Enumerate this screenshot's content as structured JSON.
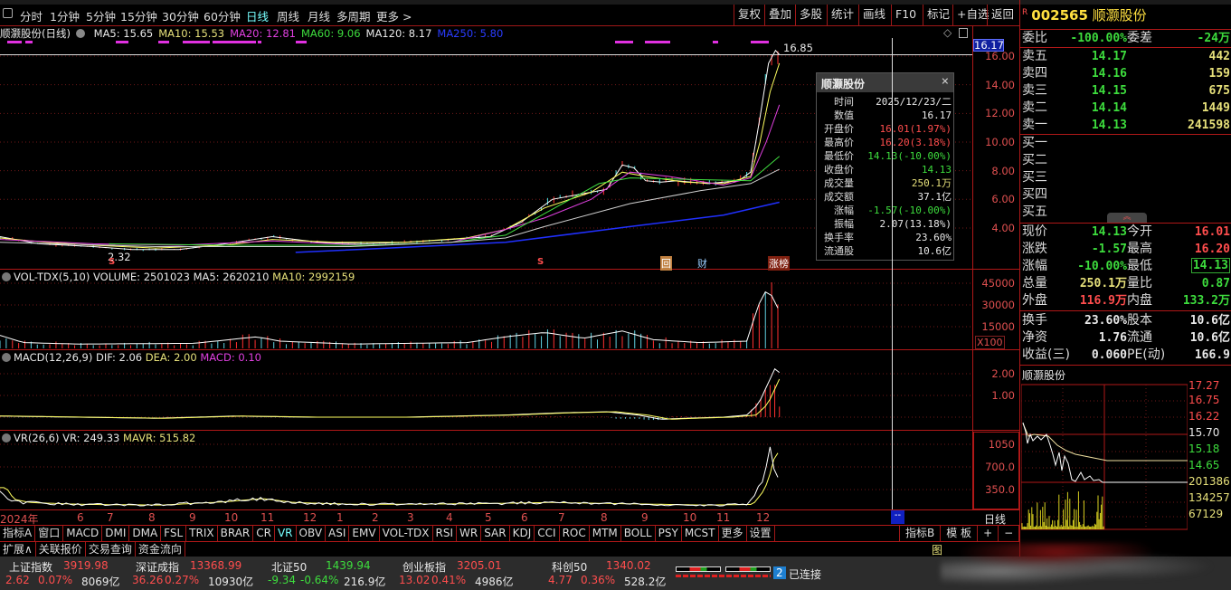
{
  "toolbar": {
    "periods": [
      "分时",
      "1分钟",
      "5分钟",
      "15分钟",
      "30分钟",
      "60分钟",
      "日线",
      "周线",
      "月线",
      "多周期",
      "更多 >"
    ],
    "active_period": "日线",
    "buttons": [
      "复权",
      "叠加",
      "多股",
      "统计",
      "画线",
      "F10",
      "标记",
      "+自选",
      "返回"
    ]
  },
  "info": {
    "title": "顺灏股份(日线)",
    "ma5": "MA5: 15.65",
    "ma10": "MA10: 15.53",
    "ma20": "MA20: 12.81",
    "ma60": "MA60: 9.06",
    "ma120": "MA120: 8.17",
    "ma250": "MA250: 5.80"
  },
  "price_axis": {
    "labels": [
      "16.00",
      "14.00",
      "12.00",
      "10.00",
      "8.00",
      "6.00",
      "4.00"
    ],
    "current": "16.17",
    "high_mark": "16.85",
    "low_mark": "2.32"
  },
  "markers": {
    "s1": "S",
    "s2": "S",
    "hui": "回",
    "cai": "财",
    "zhangbang": "涨榜"
  },
  "tooltip": {
    "title": "顺灏股份",
    "close_icon": "×",
    "rows": [
      {
        "k": "时间",
        "v": "2025/12/23/二",
        "c": "wht"
      },
      {
        "k": "数值",
        "v": "16.17",
        "c": "wht"
      },
      {
        "k": "开盘价",
        "v": "16.01(1.97%)",
        "c": "red"
      },
      {
        "k": "最高价",
        "v": "16.20(3.18%)",
        "c": "red"
      },
      {
        "k": "最低价",
        "v": "14.13(-10.00%)",
        "c": "grn"
      },
      {
        "k": "收盘价",
        "v": "14.13",
        "c": "grn"
      },
      {
        "k": "成交量",
        "v": "250.1万",
        "c": "yel"
      },
      {
        "k": "成交额",
        "v": "37.1亿",
        "c": "wht"
      },
      {
        "k": "涨幅",
        "v": "-1.57(-10.00%)",
        "c": "grn"
      },
      {
        "k": "振幅",
        "v": "2.07(13.18%)",
        "c": "wht"
      },
      {
        "k": "换手率",
        "v": "23.60%",
        "c": "wht"
      },
      {
        "k": "流通股",
        "v": "10.6亿",
        "c": "wht"
      }
    ]
  },
  "vol": {
    "title": "VOL-TDX(5,10)",
    "volume": "VOLUME: 2501023",
    "ma5": "MA5: 2620210",
    "ma10": "MA10: 2992159",
    "axis": [
      "45000",
      "30000",
      "15000"
    ],
    "unit": "X100"
  },
  "macd": {
    "title": "MACD(12,26,9)",
    "dif": "DIF: 2.06",
    "dea": "DEA: 2.00",
    "macd": "MACD: 0.10",
    "axis": [
      "2.00",
      "1.00"
    ]
  },
  "vr": {
    "title": "VR(26,6)",
    "vr": "VR: 249.33",
    "mavr": "MAVR: 515.82",
    "axis": [
      "1050",
      "700.0",
      "350.0"
    ]
  },
  "dates": [
    "2024年",
    "6",
    "7",
    "8",
    "9",
    "10",
    "11",
    "12",
    "1",
    "2",
    "3",
    "4",
    "5",
    "6",
    "7",
    "8",
    "9",
    "10",
    "11",
    "12"
  ],
  "cursor_date": "--",
  "period_label": "日线",
  "indicator_tabs": [
    "指标A",
    "窗口",
    "MACD",
    "DMI",
    "DMA",
    "FSL",
    "TRIX",
    "BRAR",
    "CR",
    "VR",
    "OBV",
    "ASI",
    "EMV",
    "VOL-TDX",
    "RSI",
    "WR",
    "SAR",
    "KDJ",
    "CCI",
    "ROC",
    "MTM",
    "BOLL",
    "PSY",
    "MCST",
    "更多",
    "设置"
  ],
  "active_indicator": "VR",
  "right_tabs": [
    "指标B",
    "模 板",
    "+",
    "−"
  ],
  "ext_tabs": [
    "扩展∧",
    "关联报价",
    "交易查询",
    "资金流向"
  ],
  "ext_right": "图",
  "quote": {
    "code": "002565",
    "name": "顺灏股份",
    "badge": "R",
    "weibi_l": "委比",
    "weibi": "-100.00%",
    "weicha_l": "委差",
    "weicha": "-24万",
    "asks": [
      {
        "l": "卖五",
        "p": "14.17",
        "q": "442"
      },
      {
        "l": "卖四",
        "p": "14.16",
        "q": "159"
      },
      {
        "l": "卖三",
        "p": "14.15",
        "q": "675"
      },
      {
        "l": "卖二",
        "p": "14.14",
        "q": "1449"
      },
      {
        "l": "卖一",
        "p": "14.13",
        "q": "241598"
      }
    ],
    "bids": [
      "买一",
      "买二",
      "买三",
      "买四",
      "买五"
    ],
    "stats": [
      {
        "l": "现价",
        "v": "14.13",
        "c": "grn",
        "l2": "今开",
        "v2": "16.01",
        "c2": "red"
      },
      {
        "l": "涨跌",
        "v": "-1.57",
        "c": "grn",
        "l2": "最高",
        "v2": "16.20",
        "c2": "red"
      },
      {
        "l": "涨幅",
        "v": "-10.00%",
        "c": "grn",
        "l2": "最低",
        "v2": "14.13",
        "c2": "grn"
      },
      {
        "l": "总量",
        "v": "250.1万",
        "c": "yel",
        "l2": "量比",
        "v2": "0.87",
        "c2": "grn"
      },
      {
        "l": "外盘",
        "v": "116.9万",
        "c": "red",
        "l2": "内盘",
        "v2": "133.2万",
        "c2": "grn"
      }
    ],
    "fund": [
      {
        "l": "换手",
        "v": "23.60%",
        "l2": "股本",
        "v2": "10.6亿"
      },
      {
        "l": "净资",
        "v": "1.76",
        "l2": "流通",
        "v2": "10.6亿"
      },
      {
        "l": "收益(三)",
        "v": "0.060",
        "l2": "PE(动)",
        "v2": "166.9"
      }
    ],
    "mini_title": "顺灏股份",
    "mini_axis": [
      {
        "v": "17.27",
        "c": "red"
      },
      {
        "v": "16.75",
        "c": "red"
      },
      {
        "v": "16.22",
        "c": "red"
      },
      {
        "v": "15.70",
        "c": "wht"
      },
      {
        "v": "15.18",
        "c": "grn"
      },
      {
        "v": "14.65",
        "c": "grn"
      },
      {
        "v": "201386",
        "c": "yel"
      },
      {
        "v": "134257",
        "c": "yel"
      },
      {
        "v": "67129",
        "c": "yel"
      }
    ]
  },
  "status": {
    "indices": [
      {
        "name": "上证指数",
        "val": "3919.98",
        "chg": "2.62",
        "pct": "0.07%",
        "amt": "8069亿",
        "c": "red"
      },
      {
        "name": "深证成指",
        "val": "13368.99",
        "chg": "36.26",
        "pct": "0.27%",
        "amt": "10930亿",
        "c": "red"
      },
      {
        "name": "北证50",
        "val": "1439.94",
        "chg": "-9.34",
        "pct": "-0.64%",
        "amt": "216.9亿",
        "c": "grn"
      },
      {
        "name": "创业板指",
        "val": "3205.01",
        "chg": "13.02",
        "pct": "0.41%",
        "amt": "4986亿",
        "c": "red"
      },
      {
        "name": "科创50",
        "val": "1340.02",
        "chg": "4.77",
        "pct": "0.36%",
        "amt": "528.2亿",
        "c": "red"
      }
    ],
    "conn_num": "2",
    "conn": "已连接"
  },
  "kline": {
    "ma5": [
      [
        0,
        3.4
      ],
      [
        5,
        2.9
      ],
      [
        12,
        2.7
      ],
      [
        17,
        2.5
      ],
      [
        23,
        2.5
      ],
      [
        29,
        2.9
      ],
      [
        35,
        3.4
      ],
      [
        41,
        3.0
      ],
      [
        47,
        2.9
      ],
      [
        52,
        3.0
      ],
      [
        58,
        3.2
      ],
      [
        63,
        3.4
      ],
      [
        67,
        4.4
      ],
      [
        71,
        6.0
      ],
      [
        74,
        6.3
      ],
      [
        78,
        6.7
      ],
      [
        80,
        8.4
      ],
      [
        81.5,
        8.2
      ],
      [
        83,
        7.3
      ],
      [
        85,
        7.2
      ],
      [
        87,
        7.3
      ],
      [
        91,
        7.1
      ],
      [
        93,
        7.2
      ],
      [
        95,
        7.3
      ],
      [
        96.5,
        7.9
      ],
      [
        97.7,
        11.7
      ],
      [
        98.8,
        15.5
      ],
      [
        99.7,
        16.4
      ],
      [
        100.2,
        16.1
      ]
    ],
    "ma10": [
      [
        0,
        3.3
      ],
      [
        6,
        3.0
      ],
      [
        12,
        2.8
      ],
      [
        20,
        2.6
      ],
      [
        29,
        2.8
      ],
      [
        35,
        3.2
      ],
      [
        43,
        3.0
      ],
      [
        52,
        3.0
      ],
      [
        60,
        3.3
      ],
      [
        65,
        3.9
      ],
      [
        70,
        5.4
      ],
      [
        76,
        6.5
      ],
      [
        80,
        7.9
      ],
      [
        83,
        7.6
      ],
      [
        88,
        7.2
      ],
      [
        93,
        7.1
      ],
      [
        96.5,
        7.6
      ],
      [
        97.7,
        10.0
      ],
      [
        99,
        13.5
      ],
      [
        100.2,
        15.5
      ]
    ],
    "ma20": [
      [
        0,
        3.2
      ],
      [
        12,
        2.9
      ],
      [
        23,
        2.8
      ],
      [
        35,
        3.1
      ],
      [
        47,
        2.8
      ],
      [
        58,
        3.0
      ],
      [
        65,
        3.9
      ],
      [
        70,
        4.7
      ],
      [
        76,
        6.0
      ],
      [
        81,
        7.9
      ],
      [
        86,
        7.6
      ],
      [
        93,
        7.0
      ],
      [
        96.5,
        7.5
      ],
      [
        98.5,
        10.0
      ],
      [
        100.2,
        12.6
      ]
    ],
    "ma60": [
      [
        14,
        2.9
      ],
      [
        30,
        2.8
      ],
      [
        47,
        2.8
      ],
      [
        58,
        3.0
      ],
      [
        65,
        3.5
      ],
      [
        70,
        5.0
      ],
      [
        77,
        7.1
      ],
      [
        81,
        7.5
      ],
      [
        88,
        7.4
      ],
      [
        96.5,
        7.3
      ],
      [
        100.2,
        9.0
      ]
    ],
    "ma120": [
      [
        0,
        3.0
      ],
      [
        20,
        2.7
      ],
      [
        45,
        2.7
      ],
      [
        58,
        3.0
      ],
      [
        65,
        3.3
      ],
      [
        70,
        4.1
      ],
      [
        81,
        5.7
      ],
      [
        90,
        6.6
      ],
      [
        96.5,
        7.1
      ],
      [
        100.2,
        8.1
      ]
    ],
    "ma250": [
      [
        38,
        2.3
      ],
      [
        50,
        2.6
      ],
      [
        65,
        3.0
      ],
      [
        81,
        4.1
      ],
      [
        93,
        4.9
      ],
      [
        100.2,
        5.8
      ]
    ],
    "volume": [
      [
        0,
        9000
      ],
      [
        3,
        4000
      ],
      [
        10,
        3000
      ],
      [
        25,
        3500
      ],
      [
        33,
        8000
      ],
      [
        36,
        5000
      ],
      [
        45,
        3000
      ],
      [
        60,
        4000
      ],
      [
        65,
        8000
      ],
      [
        70,
        11000
      ],
      [
        75,
        7000
      ],
      [
        80,
        12000
      ],
      [
        84,
        6000
      ],
      [
        90,
        4000
      ],
      [
        96,
        5000
      ],
      [
        97.5,
        30000
      ],
      [
        98.5,
        40000
      ],
      [
        99.5,
        35000
      ],
      [
        100.2,
        25000
      ]
    ],
    "macd": [
      [
        0,
        0.05
      ],
      [
        10,
        0.0
      ],
      [
        20,
        -0.05
      ],
      [
        30,
        0.05
      ],
      [
        40,
        0.0
      ],
      [
        52,
        0.0
      ],
      [
        65,
        0.1
      ],
      [
        72,
        0.2
      ],
      [
        78,
        0.25
      ],
      [
        82,
        0.1
      ],
      [
        85,
        -0.1
      ],
      [
        88,
        -0.05
      ],
      [
        93,
        0.0
      ],
      [
        96,
        0.1
      ],
      [
        97.5,
        0.6
      ],
      [
        98.8,
        1.6
      ],
      [
        99.7,
        2.3
      ],
      [
        100.2,
        2.06
      ]
    ],
    "vr": [
      [
        0,
        380
      ],
      [
        1,
        200
      ],
      [
        3,
        150
      ],
      [
        10,
        120
      ],
      [
        20,
        110
      ],
      [
        28,
        160
      ],
      [
        33,
        210
      ],
      [
        37,
        150
      ],
      [
        45,
        120
      ],
      [
        60,
        130
      ],
      [
        70,
        150
      ],
      [
        80,
        130
      ],
      [
        90,
        110
      ],
      [
        96,
        120
      ],
      [
        97.5,
        350
      ],
      [
        98.5,
        700
      ],
      [
        99,
        1000
      ],
      [
        99.7,
        700
      ],
      [
        100.2,
        500
      ]
    ]
  }
}
